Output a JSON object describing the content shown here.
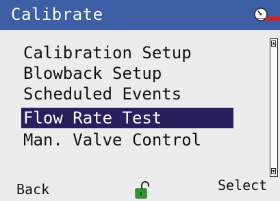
{
  "header": {
    "title": "Calibrate",
    "status_icon": "gauge-alert-icon",
    "accent_color": "#3d5fa5",
    "alert_color": "#e02020"
  },
  "menu": {
    "items": [
      {
        "label": "Calibration Setup",
        "selected": false
      },
      {
        "label": "Blowback Setup",
        "selected": false
      },
      {
        "label": "Scheduled Events",
        "selected": false
      },
      {
        "label": "Flow Rate Test",
        "selected": true
      },
      {
        "label": "Man. Valve Control",
        "selected": false
      }
    ],
    "selected_color": "#2a1f5e"
  },
  "footer": {
    "back_label": "Back",
    "select_label": "Select",
    "lock_icon": "unlocked-padlock-icon",
    "lock_color": "#2e9a2e"
  }
}
